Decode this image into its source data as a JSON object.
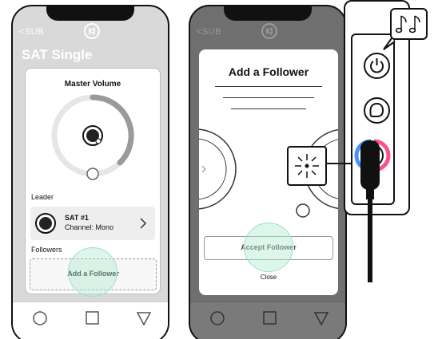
{
  "phone1": {
    "back_label": "SUB",
    "title": "SAT Single",
    "volume_title": "Master Volume",
    "leader_label": "Leader",
    "leader_name": "SAT #1",
    "leader_channel": "Channel: Mono",
    "followers_label": "Followers",
    "add_follower_label": "Add a Follower"
  },
  "phone2": {
    "back_label": "SUB",
    "modal_title": "Add a Follower",
    "accept_label": "Accept Follower",
    "close_label": "Close"
  },
  "colors": {
    "app_background": "#d9d9d9",
    "dimmed_background": "#6f6f6f",
    "tap_highlight": "#9fe0c5",
    "status_ring_blue": "#4a90ff",
    "status_ring_pink": "#ff4f8b"
  },
  "icons": [
    "chevron-left-icon",
    "brand-logo-icon",
    "speaker-icon",
    "chevron-right-icon",
    "nav-circle-icon",
    "nav-square-icon",
    "nav-triangle-icon",
    "power-icon",
    "link-icon",
    "music-note-icon",
    "blinking-light-icon",
    "cable-plug-icon"
  ]
}
